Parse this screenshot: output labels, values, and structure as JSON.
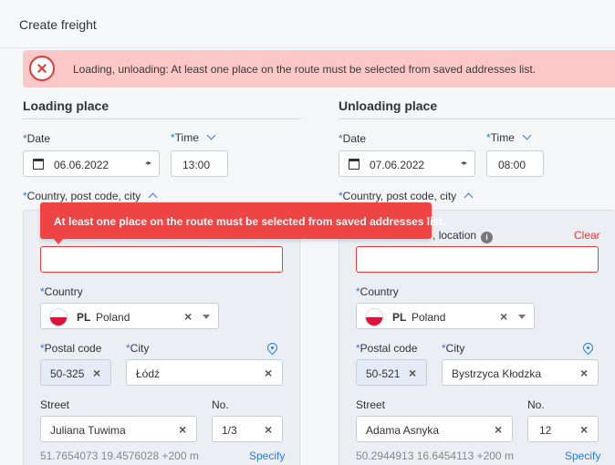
{
  "header": {
    "title": "Create freight"
  },
  "alert": {
    "message": "Loading, unloading: At least one place on the route must be selected from saved addresses list.",
    "icon": "error-circle-x-icon"
  },
  "tooltip": {
    "message": "At least one place on the route must be selected from saved addresses list."
  },
  "loading": {
    "title": "Loading place",
    "date_label": "Date",
    "date_value": "06.06.2022",
    "time_label": "Time",
    "time_value": "13:00",
    "location_label": "Country, post code, city",
    "company_value": "",
    "country_label": "Country",
    "country_code": "PL",
    "country_name": "Poland",
    "postal_label": "Postal code",
    "postal_value": "50-325",
    "city_label": "City",
    "city_value": "Łódź",
    "street_label": "Street",
    "street_value": "Juliana Tuwima",
    "no_label": "No.",
    "no_value": "1/3",
    "coords": "51.7654073 19.4576028 +200 m",
    "specify": "Specify"
  },
  "unloading": {
    "title": "Unloading place",
    "date_label": "Date",
    "date_value": "07.06.2022",
    "time_label": "Time",
    "time_value": "08:00",
    "location_label": "Country, post code, city",
    "company_label": "location",
    "company_label_prefix": ",",
    "clear": "Clear",
    "company_value": "",
    "country_label": "Country",
    "country_code": "PL",
    "country_name": "Poland",
    "postal_label": "Postal code",
    "postal_value": "50-521",
    "city_label": "City",
    "city_value": "Bystrzyca Kłodzka",
    "street_label": "Street",
    "street_value": "Adama Asnyka",
    "no_label": "No.",
    "no_value": "12",
    "coords": "50.2944913 16.6454113 +200 m",
    "specify": "Specify"
  },
  "colors": {
    "accent": "#2c7be5",
    "error": "#e53935",
    "alert_bg": "#fbc7c7",
    "tooltip_bg": "#ef4444"
  }
}
